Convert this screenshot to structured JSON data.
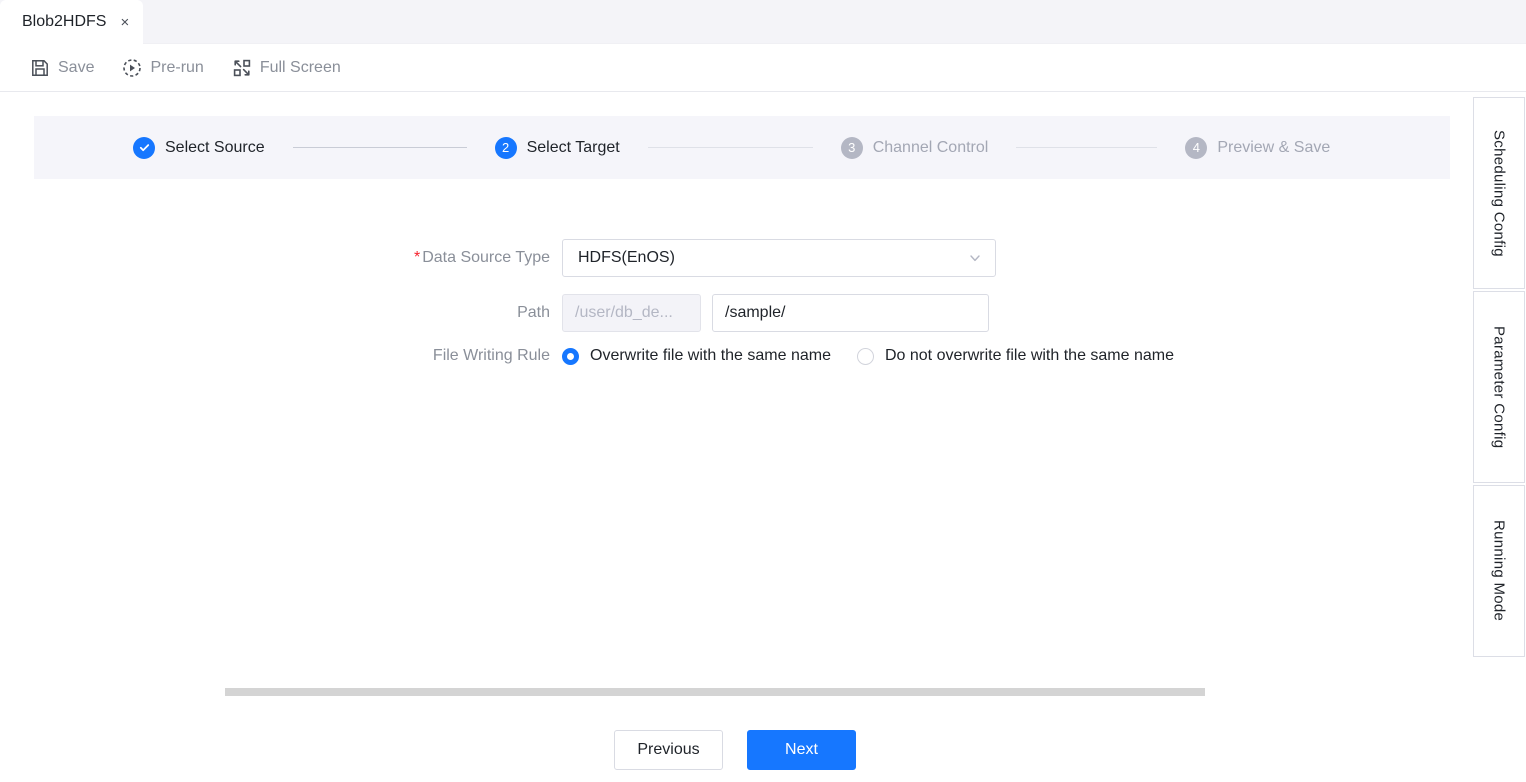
{
  "tab": {
    "label": "Blob2HDFS",
    "close": "×"
  },
  "toolbar": {
    "items": [
      {
        "label": "Save",
        "icon": "save-icon"
      },
      {
        "label": "Pre-run",
        "icon": "pre-run-icon"
      },
      {
        "label": "Full Screen",
        "icon": "full-screen-icon"
      }
    ]
  },
  "stepper": {
    "steps": [
      {
        "num": "1",
        "label": "Select Source",
        "state": "done",
        "mark": "✓"
      },
      {
        "num": "2",
        "label": "Select Target",
        "state": "active"
      },
      {
        "num": "3",
        "label": "Channel Control",
        "state": "idle"
      },
      {
        "num": "4",
        "label": "Preview & Save",
        "state": "idle"
      }
    ]
  },
  "form": {
    "data_source_type": {
      "label": "Data Source Type",
      "required_mark": "*",
      "value": "HDFS(EnOS)",
      "chevron": "chevron-down-icon"
    },
    "path": {
      "label": "Path",
      "prefix_value": "/user/db_de...",
      "input_value": "/sample/",
      "placeholder": ""
    },
    "file_writing_rule": {
      "label": "File Writing Rule",
      "options": [
        {
          "label": "Overwrite file with the same name",
          "selected": true
        },
        {
          "label": "Do not overwrite file with the same name",
          "selected": false
        }
      ]
    }
  },
  "side_tabs": [
    {
      "label": "Scheduling Config"
    },
    {
      "label": "Parameter Config"
    },
    {
      "label": "Running Mode"
    }
  ],
  "footer": {
    "previous_label": "Previous",
    "next_label": "Next"
  },
  "colors": {
    "accent": "#1677ff",
    "required": "#f5222d",
    "stepper_bg": "#f5f5fa",
    "muted_text": "#8a8f99",
    "idle_step": "#b4b7c4",
    "scrollbar": "#d4d4d4"
  }
}
